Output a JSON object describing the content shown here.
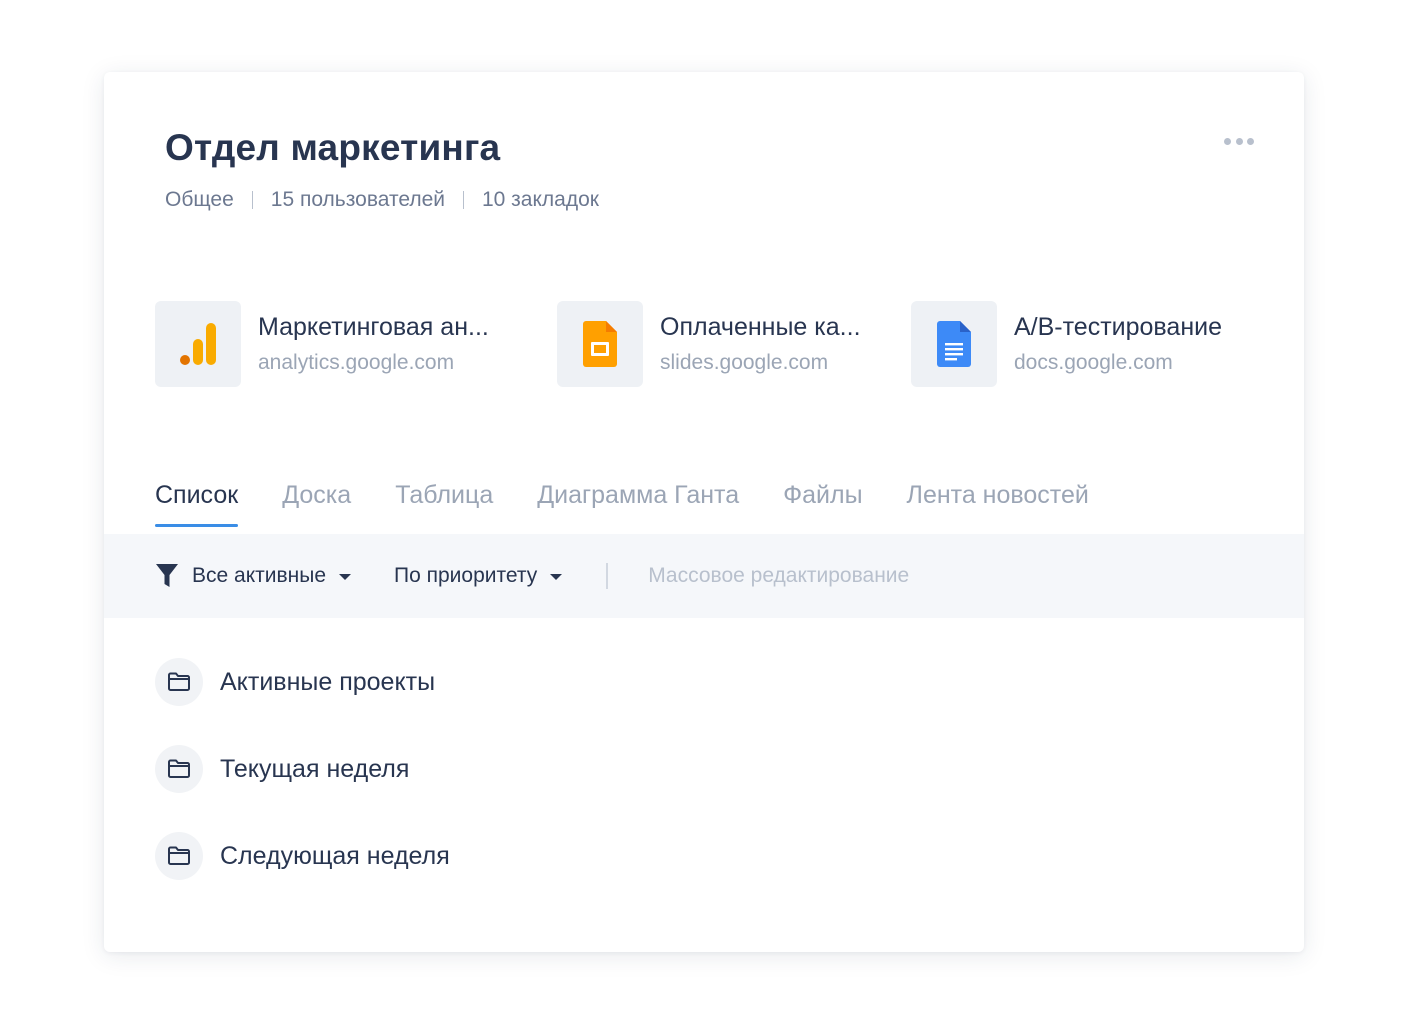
{
  "header": {
    "title": "Отдел маркетинга",
    "meta": [
      "Общее",
      "15 пользователей",
      "10 закладок"
    ]
  },
  "bookmarks": [
    {
      "title": "Маркетинговая ан...",
      "url": "analytics.google.com",
      "icon": "google-analytics-icon",
      "color": "#F9AB00"
    },
    {
      "title": "Оплаченные ка...",
      "url": "slides.google.com",
      "icon": "google-slides-icon",
      "color": "#FFA000"
    },
    {
      "title": "A/B-тестирование",
      "url": "docs.google.com",
      "icon": "google-docs-icon",
      "color": "#3D8AF7"
    }
  ],
  "tabs": [
    {
      "label": "Список",
      "active": true
    },
    {
      "label": "Доска"
    },
    {
      "label": "Таблица"
    },
    {
      "label": "Диаграмма Ганта"
    },
    {
      "label": "Файлы"
    },
    {
      "label": "Лента новостей"
    }
  ],
  "toolbar": {
    "filter_label": "Все активные",
    "sort_label": "По приоритету",
    "bulk_edit_label": "Массовое редактирование"
  },
  "folders": [
    {
      "label": "Активные проекты",
      "icon": "folder-icon"
    },
    {
      "label": "Текущая неделя",
      "icon": "folder-icon"
    },
    {
      "label": "Следующая неделя",
      "icon": "folder-icon"
    }
  ],
  "colors": {
    "accent": "#3A8DE6",
    "text_primary": "#283550",
    "text_muted": "#9BA5B5"
  }
}
